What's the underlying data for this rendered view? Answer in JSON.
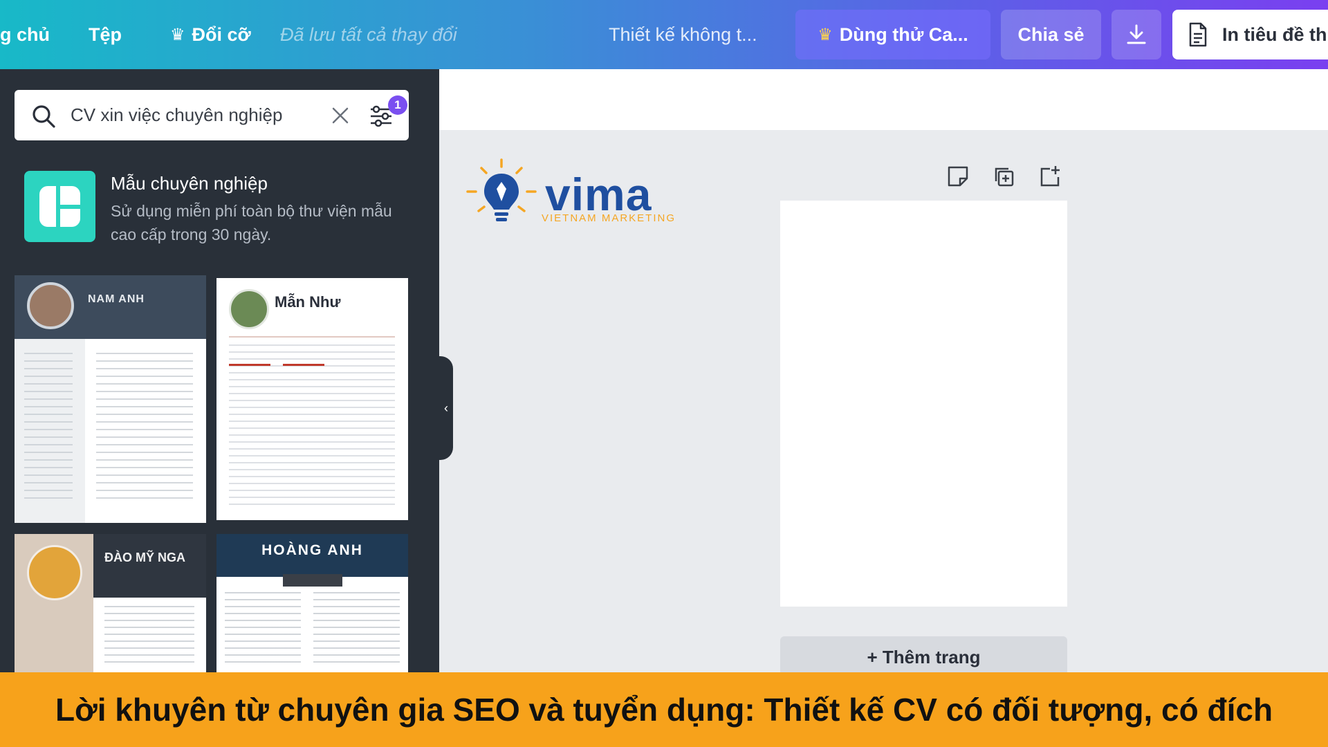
{
  "topbar": {
    "home_label": "g chủ",
    "file_label": "Tệp",
    "resize_label": "Đổi cỡ",
    "saved_status": "Đã lưu tất cả thay đổi",
    "design_title": "Thiết kế không t...",
    "trial_button": "Dùng thử Ca...",
    "share_button": "Chia sẻ",
    "print_button": "In tiêu đề th"
  },
  "search": {
    "query": "CV xin việc chuyên nghiệp",
    "filter_count": "1"
  },
  "promo": {
    "title": "Mẫu chuyên nghiệp",
    "description": "Sử dụng miễn phí toàn bộ thư viện mẫu cao cấp trong 30 ngày."
  },
  "templates": [
    {
      "name": "NAM ANH"
    },
    {
      "name": "Mẫn Như"
    },
    {
      "name": "ĐÀO MỸ NGA"
    },
    {
      "name": "HOÀNG ANH"
    }
  ],
  "canvas": {
    "add_page_label": "+ Thêm trang"
  },
  "watermark": {
    "word": "vima",
    "subtitle": "VIETNAM MARKETING"
  },
  "caption": {
    "text": "Lời khuyên từ chuyên gia SEO và tuyển dụng: Thiết kế CV có đối tượng, có đích"
  },
  "colors": {
    "panel_bg": "#293039",
    "caption_bg": "#f7a21b",
    "accent": "#7a4ff0"
  }
}
